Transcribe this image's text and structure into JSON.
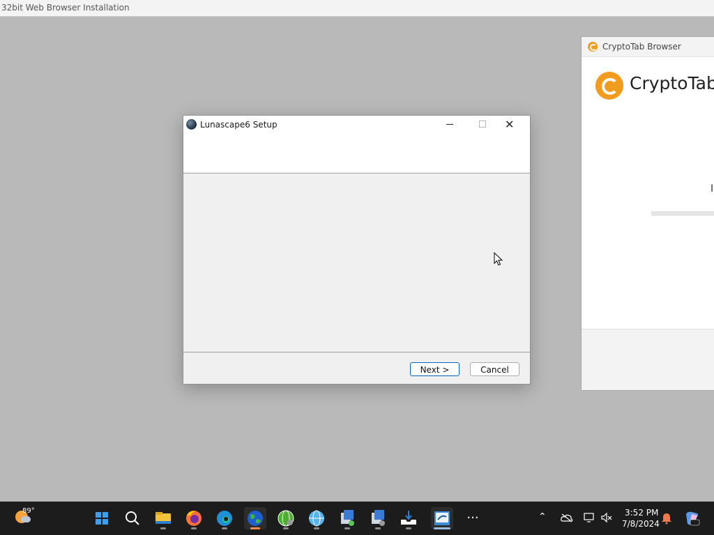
{
  "top_window": {
    "title": "32bit Web Browser Installation"
  },
  "cryptotab_window": {
    "title": "CryptoTab Browser",
    "brand": "CryptoTab",
    "partial_text": "I"
  },
  "setup_dialog": {
    "title": "Lunascape6 Setup",
    "buttons": {
      "next": "Next >",
      "cancel": "Cancel"
    }
  },
  "taskbar": {
    "weather_temp": "89°",
    "items": [
      "start-icon",
      "search-icon",
      "file-explorer-icon",
      "firefox-icon",
      "edge-icon",
      "lunascape-icon",
      "browser-globe-icon",
      "globe-icon",
      "installer-icon",
      "installer-icon-2",
      "download-tray-icon",
      "setup-icon",
      "more-icon"
    ],
    "clock_time": "3:52 PM",
    "clock_date": "7/8/2024"
  },
  "colors": {
    "accent_next": "#0067c0",
    "cryptotab_orange": "#f29c1f",
    "taskbar_bg": "#1c1c1c"
  }
}
